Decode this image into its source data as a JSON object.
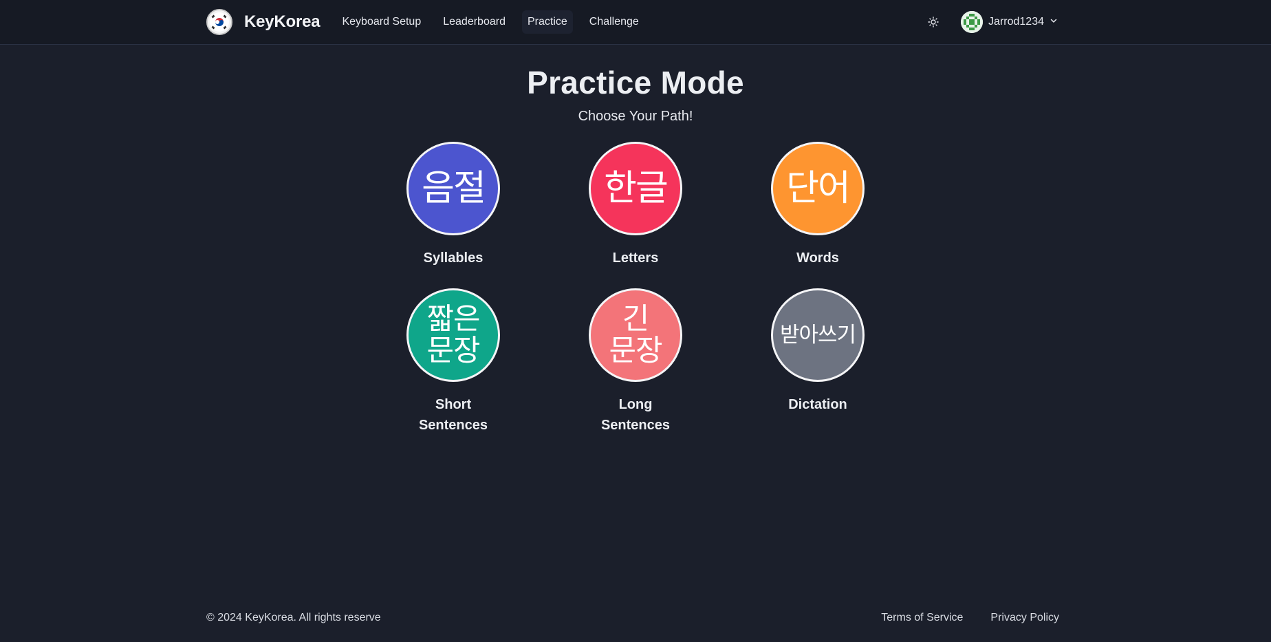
{
  "header": {
    "brand": "KeyKorea",
    "nav": [
      {
        "label": "Keyboard Setup"
      },
      {
        "label": "Leaderboard"
      },
      {
        "label": "Practice",
        "active": true
      },
      {
        "label": "Challenge"
      }
    ],
    "user": {
      "name": "Jarrod1234"
    }
  },
  "page": {
    "title": "Practice Mode",
    "subtitle": "Choose Your Path!"
  },
  "modes": [
    {
      "korean": "음절",
      "label": "Syllables",
      "color": "#4c55cf"
    },
    {
      "korean": "한글",
      "label": "Letters",
      "color": "#f5345b"
    },
    {
      "korean": "단어",
      "label": "Words",
      "color": "#fe9530"
    },
    {
      "korean_lines": [
        "짧은",
        "문장"
      ],
      "label_lines": [
        "Short",
        "Sentences"
      ],
      "color": "#0fa68a"
    },
    {
      "korean_lines": [
        "긴",
        "문장"
      ],
      "label_lines": [
        "Long",
        "Sentences"
      ],
      "color": "#f37479"
    },
    {
      "korean": "받아쓰기",
      "label": "Dictation",
      "color": "#6d7381"
    }
  ],
  "icons": {
    "logo": "korea-flag-icon",
    "theme": "sun-icon",
    "avatar": "avatar-icon",
    "chevron": "chevron-down-icon"
  },
  "footer": {
    "copyright": "© 2024 KeyKorea. All rights reserve",
    "links": [
      "Terms of Service",
      "Privacy Policy"
    ]
  }
}
